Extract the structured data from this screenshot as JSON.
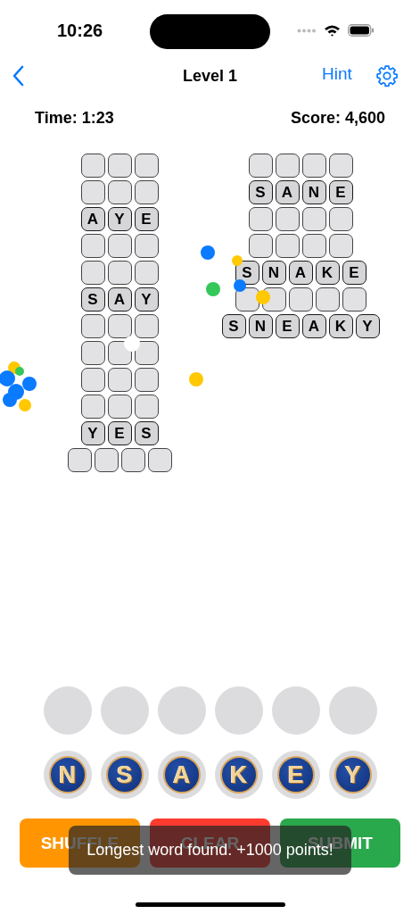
{
  "status_bar": {
    "time": "10:26"
  },
  "nav": {
    "title": "Level 1",
    "hint": "Hint"
  },
  "stats": {
    "time": "Time: 1:23",
    "score": "Score: 4,600"
  },
  "grids": [
    {
      "rows": [
        {
          "cells": [
            {
              "filled": false
            },
            {
              "filled": false
            },
            {
              "filled": false
            }
          ]
        },
        {
          "cells": [
            {
              "filled": false
            },
            {
              "filled": false
            },
            {
              "filled": false
            }
          ]
        },
        {
          "cells": [
            {
              "filled": true,
              "letter": "A"
            },
            {
              "filled": true,
              "letter": "Y"
            },
            {
              "filled": true,
              "letter": "E"
            }
          ]
        },
        {
          "cells": [
            {
              "filled": false
            },
            {
              "filled": false
            },
            {
              "filled": false
            }
          ]
        },
        {
          "cells": [
            {
              "filled": false
            },
            {
              "filled": false
            },
            {
              "filled": false
            }
          ]
        },
        {
          "cells": [
            {
              "filled": true,
              "letter": "S"
            },
            {
              "filled": true,
              "letter": "A"
            },
            {
              "filled": true,
              "letter": "Y"
            }
          ]
        },
        {
          "cells": [
            {
              "filled": false
            },
            {
              "filled": false
            },
            {
              "filled": false
            }
          ]
        },
        {
          "cells": [
            {
              "filled": false
            },
            {
              "filled": false
            },
            {
              "filled": false
            }
          ]
        },
        {
          "cells": [
            {
              "filled": false
            },
            {
              "filled": false
            },
            {
              "filled": false
            }
          ]
        },
        {
          "cells": [
            {
              "filled": false
            },
            {
              "filled": false
            },
            {
              "filled": false
            }
          ]
        },
        {
          "cells": [
            {
              "filled": true,
              "letter": "Y"
            },
            {
              "filled": true,
              "letter": "E"
            },
            {
              "filled": true,
              "letter": "S"
            }
          ]
        },
        {
          "cells": [
            {
              "filled": false
            },
            {
              "filled": false
            },
            {
              "filled": false
            },
            {
              "filled": false
            }
          ]
        }
      ]
    },
    {
      "rows": [
        {
          "cells": [
            {
              "filled": false
            },
            {
              "filled": false
            },
            {
              "filled": false
            },
            {
              "filled": false
            }
          ]
        },
        {
          "cells": [
            {
              "filled": true,
              "letter": "S"
            },
            {
              "filled": true,
              "letter": "A"
            },
            {
              "filled": true,
              "letter": "N"
            },
            {
              "filled": true,
              "letter": "E"
            }
          ]
        },
        {
          "cells": [
            {
              "filled": false
            },
            {
              "filled": false
            },
            {
              "filled": false
            },
            {
              "filled": false
            }
          ]
        },
        {
          "cells": [
            {
              "filled": false
            },
            {
              "filled": false
            },
            {
              "filled": false
            },
            {
              "filled": false
            }
          ]
        },
        {
          "cells": [
            {
              "filled": true,
              "letter": "S"
            },
            {
              "filled": true,
              "letter": "N"
            },
            {
              "filled": true,
              "letter": "A"
            },
            {
              "filled": true,
              "letter": "K"
            },
            {
              "filled": true,
              "letter": "E"
            }
          ]
        },
        {
          "cells": [
            {
              "filled": false
            },
            {
              "filled": false
            },
            {
              "filled": false
            },
            {
              "filled": false
            },
            {
              "filled": false
            }
          ]
        },
        {
          "cells": [
            {
              "filled": true,
              "letter": "S"
            },
            {
              "filled": true,
              "letter": "N"
            },
            {
              "filled": true,
              "letter": "E"
            },
            {
              "filled": true,
              "letter": "A"
            },
            {
              "filled": true,
              "letter": "K"
            },
            {
              "filled": true,
              "letter": "Y"
            }
          ]
        }
      ]
    }
  ],
  "answer_slots": [
    {
      "filled": false
    },
    {
      "filled": false
    },
    {
      "filled": false
    },
    {
      "filled": false
    },
    {
      "filled": false
    },
    {
      "filled": false
    }
  ],
  "letter_tiles": [
    {
      "letter": "N"
    },
    {
      "letter": "S"
    },
    {
      "letter": "A"
    },
    {
      "letter": "K"
    },
    {
      "letter": "E"
    },
    {
      "letter": "Y"
    }
  ],
  "buttons": [
    {
      "label": "SHUFFLE",
      "kind": "shuffle"
    },
    {
      "label": "CLEAR",
      "kind": "clear"
    },
    {
      "label": "SUBMIT",
      "kind": "submit"
    }
  ],
  "toast": {
    "message": "Longest word found. +1000 points!"
  }
}
